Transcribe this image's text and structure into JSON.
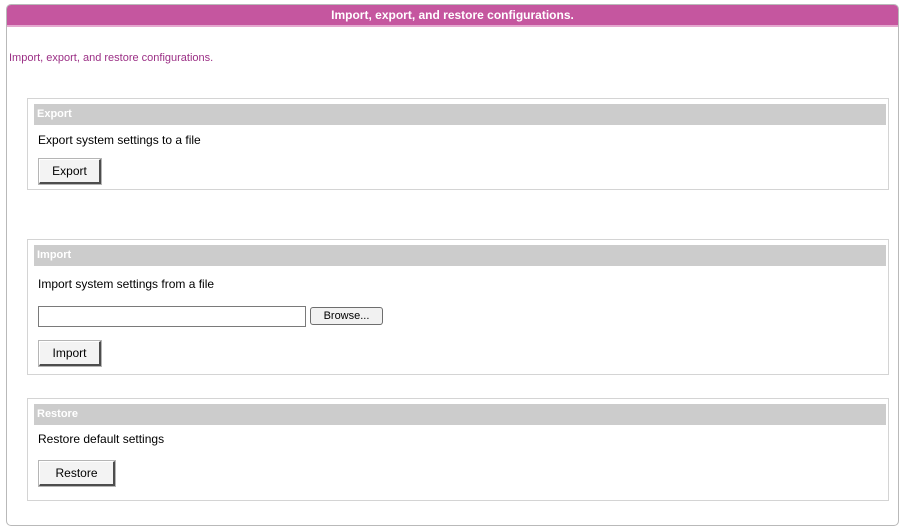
{
  "header": {
    "title": "Import, export, and restore configurations."
  },
  "subtitle": "Import, export, and restore configurations.",
  "export_section": {
    "heading": "Export",
    "description": "Export system settings to a file",
    "button_label": "Export"
  },
  "import_section": {
    "heading": "Import",
    "description": "Import system settings from a file",
    "file_value": "",
    "browse_label": "Browse...",
    "button_label": "Import"
  },
  "restore_section": {
    "heading": "Restore",
    "description": "Restore default settings",
    "button_label": "Restore"
  },
  "colors": {
    "title_bar": "#c5569f",
    "subtitle_text": "#9b2f85",
    "section_header": "#cccccc"
  }
}
